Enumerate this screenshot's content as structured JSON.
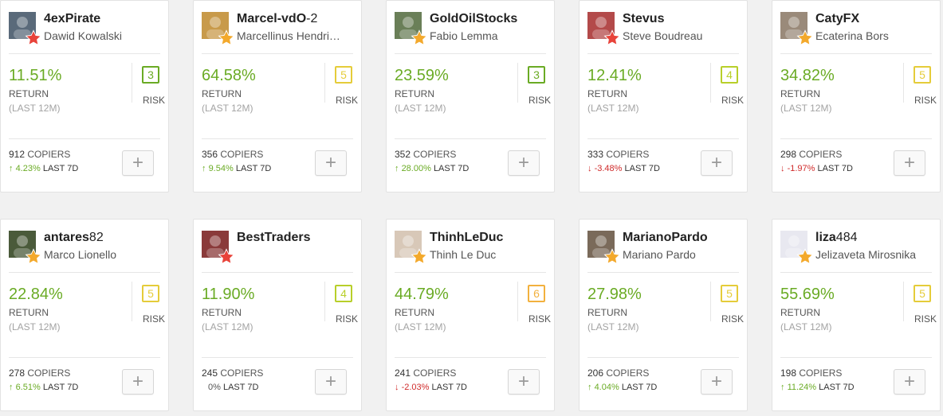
{
  "labels": {
    "return": "RETURN",
    "period": "(LAST 12M)",
    "risk": "RISK",
    "copiers": "COPIERS",
    "last7d": "LAST 7D",
    "add": "+"
  },
  "colors": {
    "return_green": "#6aab24",
    "negative_red": "#d02b2b",
    "risk_3": "#6aab24",
    "risk_4": "#b8cf2a",
    "risk_5": "#e5cc3a",
    "risk_6": "#f2b13e",
    "star_red": "#e8433a",
    "star_gold": "#f3a92c"
  },
  "traders": [
    {
      "username": "4exPirate",
      "username_suffix": "",
      "full_name": "Dawid Kowalski",
      "star": "red",
      "return": "11.51%",
      "risk": "3",
      "copiers": "912",
      "change": "4.23%",
      "direction": "up"
    },
    {
      "username": "Marcel-vdO",
      "username_suffix": "-2",
      "full_name": "Marcellinus Hendri…",
      "star": "gold",
      "return": "64.58%",
      "risk": "5",
      "copiers": "356",
      "change": "9.54%",
      "direction": "up"
    },
    {
      "username": "GoldOilStocks",
      "username_suffix": "",
      "full_name": "Fabio Lemma",
      "star": "gold",
      "return": "23.59%",
      "risk": "3",
      "copiers": "352",
      "change": "28.00%",
      "direction": "up"
    },
    {
      "username": "Stevus",
      "username_suffix": "",
      "full_name": "Steve Boudreau",
      "star": "red",
      "return": "12.41%",
      "risk": "4",
      "copiers": "333",
      "change": "-3.48%",
      "direction": "down"
    },
    {
      "username": "CatyFX",
      "username_suffix": "",
      "full_name": "Ecaterina Bors",
      "star": "gold",
      "return": "34.82%",
      "risk": "5",
      "copiers": "298",
      "change": "-1.97%",
      "direction": "down"
    },
    {
      "username": "antares",
      "username_suffix": "82",
      "full_name": "Marco Lionello",
      "star": "gold",
      "return": "22.84%",
      "risk": "5",
      "copiers": "278",
      "change": "6.51%",
      "direction": "up"
    },
    {
      "username": "BestTraders",
      "username_suffix": "",
      "full_name": "",
      "star": "red",
      "return": "11.90%",
      "risk": "4",
      "copiers": "245",
      "change": "0%",
      "direction": "none"
    },
    {
      "username": "ThinhLeDuc",
      "username_suffix": "",
      "full_name": "Thinh Le Duc",
      "star": "gold",
      "return": "44.79%",
      "risk": "6",
      "copiers": "241",
      "change": "-2.03%",
      "direction": "down"
    },
    {
      "username": "MarianoPardo",
      "username_suffix": "",
      "full_name": "Mariano Pardo",
      "star": "gold",
      "return": "27.98%",
      "risk": "5",
      "copiers": "206",
      "change": "4.04%",
      "direction": "up"
    },
    {
      "username": "liza",
      "username_suffix": "484",
      "full_name": "Jelizaveta Mirosnika",
      "star": "gold",
      "return": "55.69%",
      "risk": "5",
      "copiers": "198",
      "change": "11.24%",
      "direction": "up"
    }
  ]
}
